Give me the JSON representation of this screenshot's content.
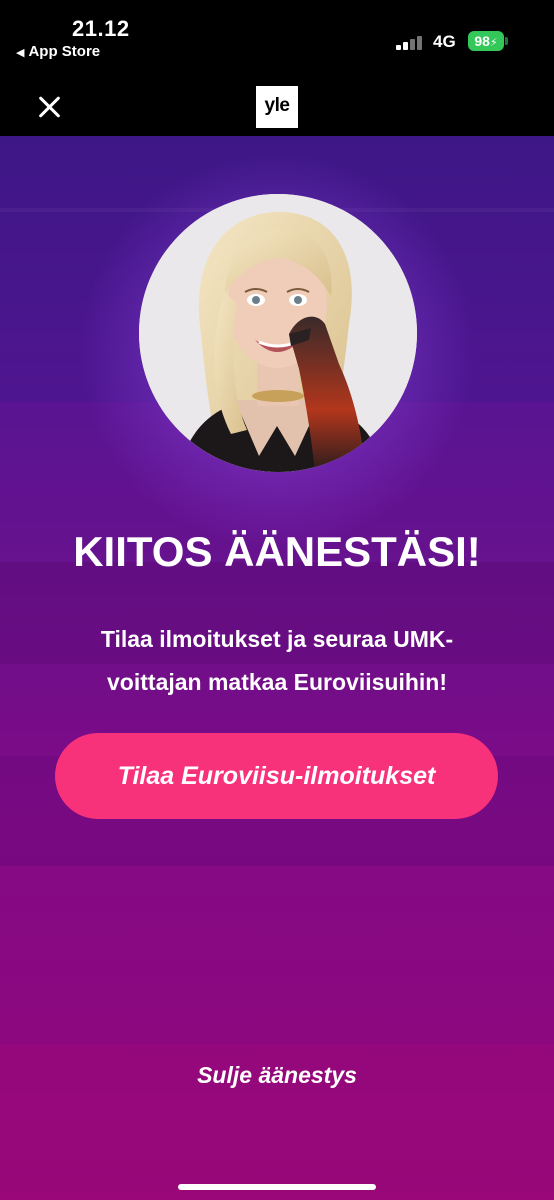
{
  "status_bar": {
    "time": "21.12",
    "back_label": "App Store",
    "network": "4G",
    "battery": "98"
  },
  "header": {
    "logo_text": "yle",
    "close_icon": "close-icon"
  },
  "main": {
    "title": "KIITOS ÄÄNESTÄSI!",
    "subtitle": "Tilaa ilmoitukset ja seuraa UMK-voittajan matkaa Euroviisuihin!",
    "cta_label": "Tilaa Euroviisu-ilmoitukset",
    "close_label": "Sulje äänestys"
  },
  "colors": {
    "accent": "#f7317a",
    "background_top": "#3e1786",
    "background_bottom": "#930679",
    "battery": "#34c759"
  }
}
